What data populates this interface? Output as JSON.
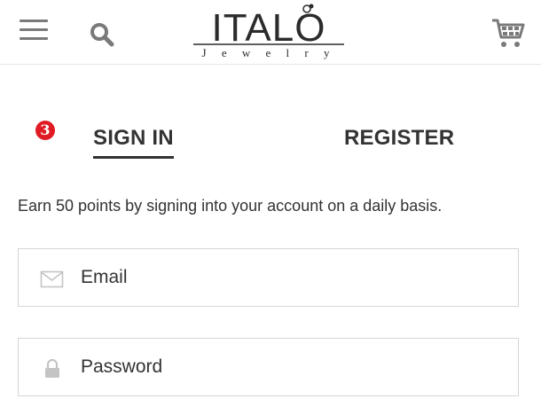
{
  "header": {
    "logo_title": "ITALO",
    "logo_subtitle": "J e w e l r y"
  },
  "auth": {
    "step_badge": "3",
    "tabs": [
      {
        "label": "SIGN IN",
        "active": true
      },
      {
        "label": "REGISTER",
        "active": false
      }
    ],
    "intro_text": "Earn 50 points by signing into your account on a daily basis.",
    "email": {
      "placeholder": "Email",
      "value": ""
    },
    "password": {
      "placeholder": "Password",
      "value": ""
    }
  },
  "icons": {
    "menu": "hamburger-menu-icon",
    "search": "search-icon",
    "cart": "shopping-cart-icon",
    "email": "envelope-icon",
    "password": "lock-icon"
  },
  "colors": {
    "badge": "#e01b24",
    "icon_gray": "#7a7a7a",
    "text": "#333333",
    "border": "#d6d6d6"
  }
}
